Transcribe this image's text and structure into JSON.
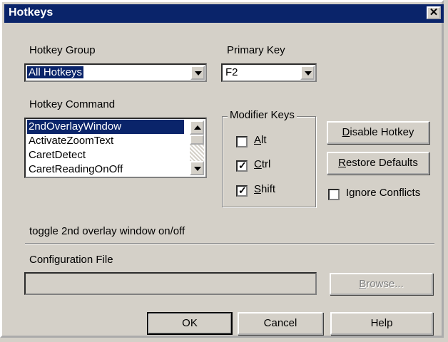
{
  "window": {
    "title": "Hotkeys",
    "close_glyph": "✕"
  },
  "hotkey_group": {
    "label": "Hotkey Group",
    "value": "All Hotkeys"
  },
  "primary_key": {
    "label": "Primary Key",
    "value": "F2"
  },
  "hotkey_command": {
    "label": "Hotkey Command",
    "items": [
      "2ndOverlayWindow",
      "ActivateZoomText",
      "CaretDetect",
      "CaretReadingOnOff"
    ],
    "selected_index": 0
  },
  "modifier_keys": {
    "title": "Modifier Keys",
    "items": [
      {
        "label": "Alt",
        "checked": false
      },
      {
        "label": "Ctrl",
        "checked": true
      },
      {
        "label": "Shift",
        "checked": true
      }
    ]
  },
  "buttons": {
    "disable_hotkey": "Disable Hotkey",
    "restore_defaults": "Restore Defaults",
    "browse": "Browse...",
    "ok": "OK",
    "cancel": "Cancel",
    "help": "Help"
  },
  "ignore_conflicts": {
    "label": "Ignore Conflicts",
    "checked": false
  },
  "description": "toggle 2nd overlay window on/off",
  "configuration_file": {
    "label": "Configuration File",
    "value": ""
  },
  "icons": {
    "dropdown": "chevron-down-icon",
    "scroll_up": "arrow-up-icon",
    "scroll_down": "arrow-down-icon",
    "check": "checkmark-icon"
  }
}
